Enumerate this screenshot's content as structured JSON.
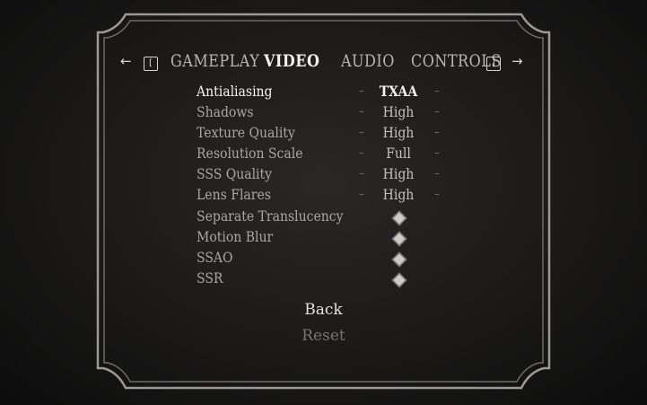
{
  "tabs": {
    "prev_arrow": "←",
    "prev_key": "[",
    "items": [
      "GAMEPLAY",
      "VIDEO",
      "AUDIO",
      "CONTROLS"
    ],
    "active": "VIDEO",
    "next_key": "]",
    "next_arrow": "→"
  },
  "settings": [
    {
      "label": "Antialiasing",
      "type": "select",
      "value": "TXAA",
      "selected": true
    },
    {
      "label": "Shadows",
      "type": "select",
      "value": "High"
    },
    {
      "label": "Texture Quality",
      "type": "select",
      "value": "High"
    },
    {
      "label": "Resolution Scale",
      "type": "select",
      "value": "Full"
    },
    {
      "label": "SSS Quality",
      "type": "select",
      "value": "High"
    },
    {
      "label": "Lens Flares",
      "type": "select",
      "value": "High"
    },
    {
      "label": "Separate Translucency",
      "type": "toggle",
      "value": "on"
    },
    {
      "label": "Motion Blur",
      "type": "toggle",
      "value": "on"
    },
    {
      "label": "SSAO",
      "type": "toggle",
      "value": "on"
    },
    {
      "label": "SSR",
      "type": "toggle",
      "value": "on"
    }
  ],
  "stepper": {
    "dec": "–",
    "inc": "–"
  },
  "buttons": {
    "back": "Back",
    "reset": "Reset"
  }
}
